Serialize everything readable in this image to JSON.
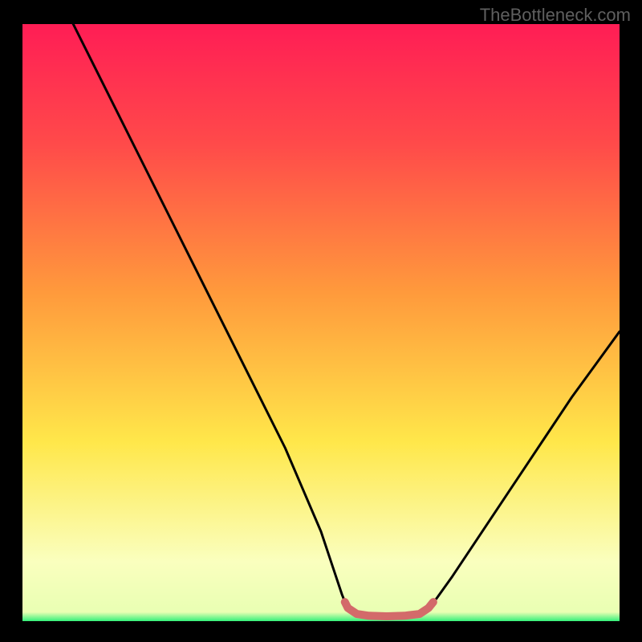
{
  "watermark": "TheBottleneck.com",
  "chart_data": {
    "type": "line",
    "title": "",
    "xlabel": "",
    "ylabel": "",
    "xlim": [
      0,
      1
    ],
    "ylim": [
      0,
      1
    ],
    "gradient_stops": [
      {
        "offset": 0.0,
        "color": "#33f07a"
      },
      {
        "offset": 0.015,
        "color": "#e9ffb3"
      },
      {
        "offset": 0.1,
        "color": "#faffbe"
      },
      {
        "offset": 0.3,
        "color": "#ffe74a"
      },
      {
        "offset": 0.55,
        "color": "#ff9a3c"
      },
      {
        "offset": 0.8,
        "color": "#ff4a4a"
      },
      {
        "offset": 1.0,
        "color": "#ff1d55"
      }
    ],
    "series": [
      {
        "name": "curve-left",
        "stroke": "#000000",
        "stroke_width": 3,
        "points": [
          {
            "x": 0.085,
            "y": 1.0
          },
          {
            "x": 0.12,
            "y": 0.93
          },
          {
            "x": 0.16,
            "y": 0.85
          },
          {
            "x": 0.2,
            "y": 0.77
          },
          {
            "x": 0.24,
            "y": 0.69
          },
          {
            "x": 0.28,
            "y": 0.61
          },
          {
            "x": 0.32,
            "y": 0.53
          },
          {
            "x": 0.36,
            "y": 0.45
          },
          {
            "x": 0.4,
            "y": 0.37
          },
          {
            "x": 0.44,
            "y": 0.29
          },
          {
            "x": 0.47,
            "y": 0.22
          },
          {
            "x": 0.5,
            "y": 0.15
          },
          {
            "x": 0.52,
            "y": 0.09
          },
          {
            "x": 0.535,
            "y": 0.045
          },
          {
            "x": 0.545,
            "y": 0.02
          }
        ]
      },
      {
        "name": "curve-right",
        "stroke": "#000000",
        "stroke_width": 3,
        "points": [
          {
            "x": 0.68,
            "y": 0.02
          },
          {
            "x": 0.695,
            "y": 0.04
          },
          {
            "x": 0.72,
            "y": 0.075
          },
          {
            "x": 0.76,
            "y": 0.135
          },
          {
            "x": 0.8,
            "y": 0.195
          },
          {
            "x": 0.84,
            "y": 0.255
          },
          {
            "x": 0.88,
            "y": 0.315
          },
          {
            "x": 0.92,
            "y": 0.375
          },
          {
            "x": 0.96,
            "y": 0.43
          },
          {
            "x": 1.0,
            "y": 0.485
          }
        ]
      },
      {
        "name": "highlight-bottom",
        "stroke": "#d36a6a",
        "stroke_width": 10,
        "points": [
          {
            "x": 0.54,
            "y": 0.032
          },
          {
            "x": 0.545,
            "y": 0.022
          },
          {
            "x": 0.56,
            "y": 0.012
          },
          {
            "x": 0.58,
            "y": 0.009
          },
          {
            "x": 0.61,
            "y": 0.008
          },
          {
            "x": 0.64,
            "y": 0.009
          },
          {
            "x": 0.665,
            "y": 0.012
          },
          {
            "x": 0.68,
            "y": 0.022
          },
          {
            "x": 0.688,
            "y": 0.032
          }
        ]
      }
    ]
  }
}
